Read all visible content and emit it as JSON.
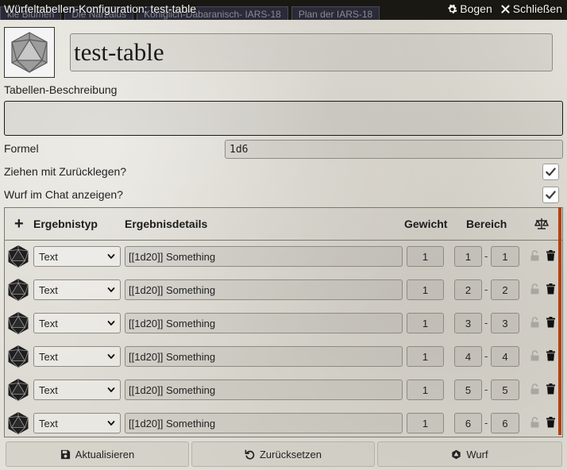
{
  "header": {
    "title": "Würfeltabellen-Konfiguration: test-table",
    "background_tabs": [
      "kle Blumen",
      "Die Narzalus",
      "Königlich-Dabaranisch- IARS-18",
      "Plan der IARS-18"
    ],
    "sheet_label": "Bogen",
    "close_label": "Schließen"
  },
  "table": {
    "name": "test-table",
    "description_label": "Tabellen-Beschreibung",
    "description": "",
    "formula_label": "Formel",
    "formula": "1d6",
    "replacement_label": "Ziehen mit Zurücklegen?",
    "replacement": true,
    "display_roll_label": "Wurf im Chat anzeigen?",
    "display_roll": true
  },
  "results_header": {
    "add": "+",
    "type": "Ergebnistyp",
    "details": "Ergebnisdetails",
    "weight": "Gewicht",
    "range": "Bereich"
  },
  "results": [
    {
      "type": "Text",
      "details": "[[1d20]] Something",
      "weight": "1",
      "range_low": "1",
      "range_high": "1"
    },
    {
      "type": "Text",
      "details": "[[1d20]] Something",
      "weight": "1",
      "range_low": "2",
      "range_high": "2"
    },
    {
      "type": "Text",
      "details": "[[1d20]] Something",
      "weight": "1",
      "range_low": "3",
      "range_high": "3"
    },
    {
      "type": "Text",
      "details": "[[1d20]] Something",
      "weight": "1",
      "range_low": "4",
      "range_high": "4"
    },
    {
      "type": "Text",
      "details": "[[1d20]] Something",
      "weight": "1",
      "range_low": "5",
      "range_high": "5"
    },
    {
      "type": "Text",
      "details": "[[1d20]] Something",
      "weight": "1",
      "range_low": "6",
      "range_high": "6"
    }
  ],
  "range_separator": "-",
  "footer": {
    "update": "Aktualisieren",
    "reset": "Zurücksetzen",
    "roll": "Wurf"
  },
  "icons": {
    "header_sheet": "gear-icon",
    "header_close": "close-icon",
    "table_image": "d20-icon",
    "add": "plus-icon",
    "normalize": "balance-scale-icon",
    "row_image": "d20-icon",
    "row_lock": "unlock-icon",
    "row_delete": "trash-icon",
    "update": "save-icon",
    "reset": "undo-icon",
    "roll": "dice-icon"
  },
  "colors": {
    "header_bg": "#191813",
    "scroll_accent": "#b2410f",
    "checkbox_mark": "#3c3c3c"
  }
}
